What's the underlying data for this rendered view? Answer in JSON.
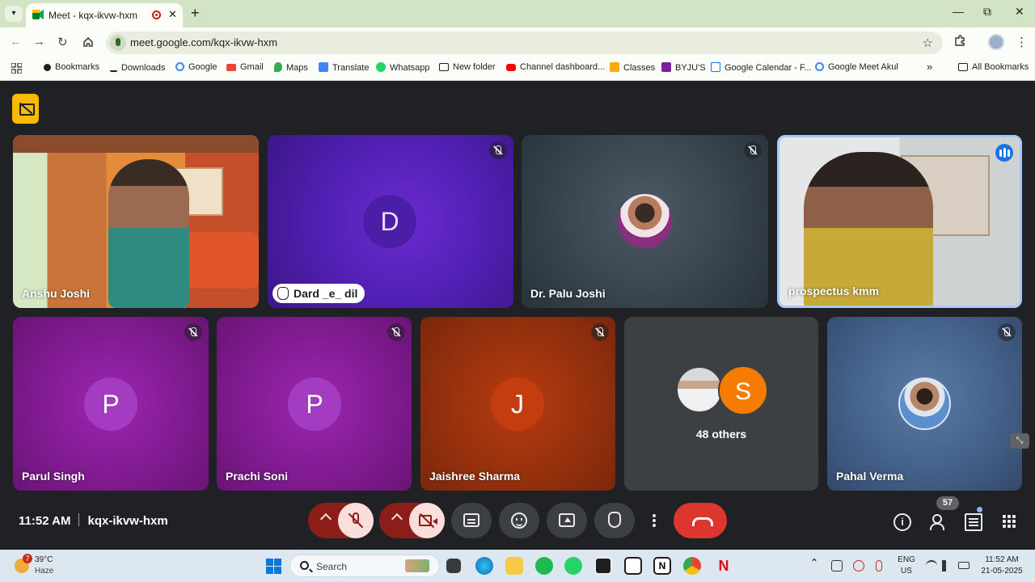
{
  "browser": {
    "tab_title": "Meet - kqx-ikvw-hxm",
    "tab_close": "✕",
    "new_tab": "+",
    "window_minimize": "—",
    "window_maximize": "⧉",
    "window_close": "✕",
    "url": "meet.google.com/kqx-ikvw-hxm",
    "bookmarks": [
      {
        "label": "Bookmarks",
        "icon": "star-icon",
        "color": "#1f1f1f"
      },
      {
        "label": "Downloads",
        "icon": "download-icon",
        "color": "#1f1f1f"
      },
      {
        "label": "Google",
        "icon": "google-icon",
        "color": "#4285f4"
      },
      {
        "label": "Gmail",
        "icon": "gmail-icon",
        "color": "#ea4335"
      },
      {
        "label": "Maps",
        "icon": "maps-icon",
        "color": "#34a853"
      },
      {
        "label": "Translate",
        "icon": "translate-icon",
        "color": "#4285f4"
      },
      {
        "label": "Whatsapp",
        "icon": "whatsapp-icon",
        "color": "#25d366"
      },
      {
        "label": "New folder",
        "icon": "folder-icon",
        "color": "#1f1f1f"
      },
      {
        "label": "Channel dashboard...",
        "icon": "youtube-icon",
        "color": "#ff0000"
      },
      {
        "label": "Classes",
        "icon": "classroom-icon",
        "color": "#f9ab00"
      },
      {
        "label": "BYJU'S",
        "icon": "byjus-icon",
        "color": "#7b1fa2"
      },
      {
        "label": "Google Calendar - F...",
        "icon": "calendar-icon",
        "color": "#1a73e8"
      },
      {
        "label": "Google Meet Akul",
        "icon": "google-icon",
        "color": "#4285f4"
      }
    ],
    "bookmarks_overflow": "»",
    "all_bookmarks": "All Bookmarks"
  },
  "meet": {
    "tiles": [
      {
        "name": "Anshu Joshi",
        "type": "video",
        "muted": false
      },
      {
        "name": "Dard _e_ dil",
        "type": "avatar",
        "letter": "D",
        "muted": true,
        "hand_raised": true
      },
      {
        "name": "Dr. Palu Joshi",
        "type": "photo",
        "muted": true
      },
      {
        "name": "prospectus kmm",
        "type": "video",
        "speaking": true
      },
      {
        "name": "Parul Singh",
        "type": "avatar",
        "letter": "P",
        "muted": true
      },
      {
        "name": "Prachi Soni",
        "type": "avatar",
        "letter": "P",
        "muted": true
      },
      {
        "name": "Jaishree Sharma",
        "type": "avatar",
        "letter": "J",
        "muted": true
      },
      {
        "name": "48 others",
        "type": "others",
        "letter": "S"
      },
      {
        "name": "Pahal Verma",
        "type": "photo",
        "muted": true
      }
    ],
    "time": "11:52 AM",
    "meeting_code": "kqx-ikvw-hxm",
    "people_count": "57",
    "colors": {
      "stage_bg": "#202124",
      "mic_off_pill": "#f9dedc",
      "mic_off_group": "#8c1d18",
      "end_call": "#dc362e",
      "control_bg": "#3c4043",
      "speaking_border": "#a8c7fa"
    }
  },
  "taskbar": {
    "weather_temp": "39°C",
    "weather_desc": "Haze",
    "weather_badge": "7",
    "search_placeholder": "Search",
    "language_top": "ENG",
    "language_bottom": "US",
    "clock_time": "11:52 AM",
    "clock_date": "21-05-2025",
    "apps": [
      "file-explorer-app-icon",
      "edge-icon",
      "folder-icon",
      "spotify-icon",
      "whatsapp-icon",
      "dark-app-icon",
      "calendar-icon",
      "notion-icon",
      "chrome-icon",
      "netflix-icon"
    ]
  }
}
